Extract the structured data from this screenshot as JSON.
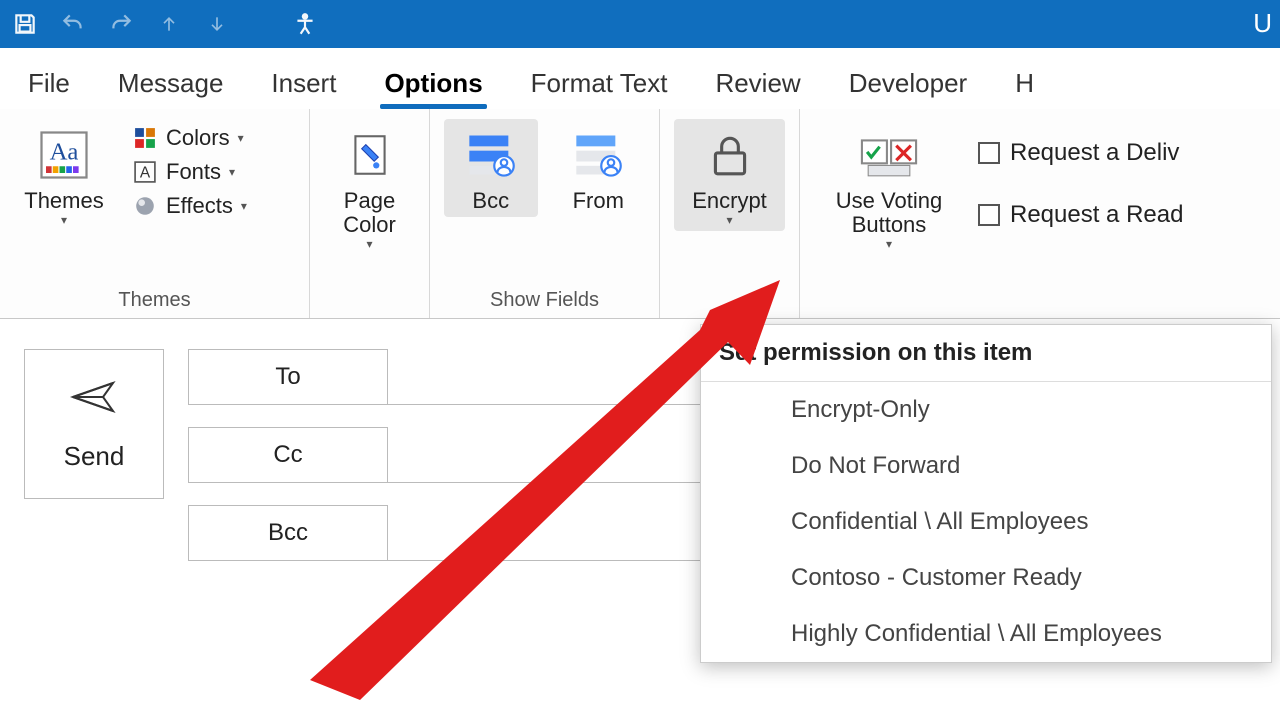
{
  "titlebar": {
    "right_text": "U"
  },
  "tabs": {
    "items": [
      "File",
      "Message",
      "Insert",
      "Options",
      "Format Text",
      "Review",
      "Developer",
      "H"
    ],
    "active_index": 3
  },
  "ribbon": {
    "groups": {
      "themes": {
        "label": "Themes",
        "themes_btn": "Themes",
        "colors": "Colors",
        "fonts": "Fonts",
        "effects": "Effects",
        "page_color": "Page\nColor"
      },
      "show_fields": {
        "label": "Show Fields",
        "bcc": "Bcc",
        "from": "From"
      },
      "encrypt": {
        "btn": "Encrypt"
      },
      "tracking": {
        "voting": "Use Voting\nButtons",
        "delivery": "Request a Deliv",
        "read": "Request a Read"
      }
    }
  },
  "compose": {
    "send": "Send",
    "to": "To",
    "cc": "Cc",
    "bcc": "Bcc"
  },
  "dropdown": {
    "title": "Set permission on this item",
    "items": [
      "Encrypt-Only",
      "Do Not Forward",
      "Confidential \\ All Employees",
      "Contoso - Customer Ready",
      "Highly Confidential \\ All Employees"
    ]
  }
}
